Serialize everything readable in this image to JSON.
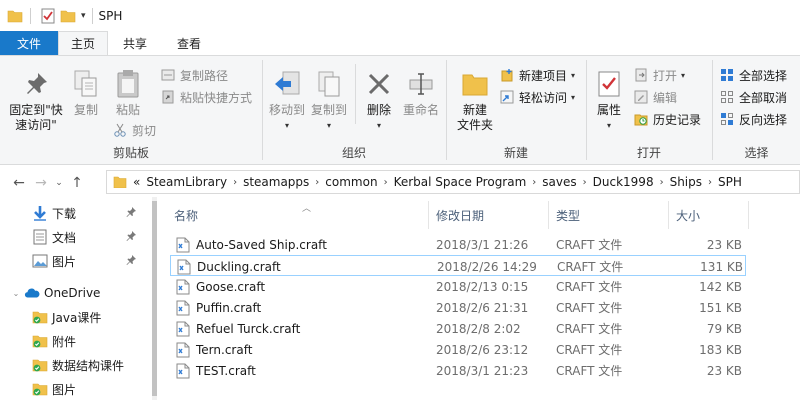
{
  "window": {
    "title": "SPH"
  },
  "ribbon_tabs": {
    "file": "文件",
    "home": "主页",
    "share": "共享",
    "view": "查看"
  },
  "clipboard": {
    "pin_label_1": "固定到\"快",
    "pin_label_2": "速访问\"",
    "copy": "复制",
    "paste": "粘贴",
    "copy_path": "复制路径",
    "paste_shortcut": "粘贴快捷方式",
    "cut": "剪切",
    "group": "剪贴板"
  },
  "organize": {
    "move_to": "移动到",
    "copy_to": "复制到",
    "delete": "删除",
    "rename": "重命名",
    "group": "组织"
  },
  "new": {
    "new_folder_1": "新建",
    "new_folder_2": "文件夹",
    "new_item": "新建项目",
    "easy_access": "轻松访问",
    "group": "新建"
  },
  "open": {
    "properties": "属性",
    "open": "打开",
    "edit": "编辑",
    "history": "历史记录",
    "group": "打开"
  },
  "select": {
    "select_all": "全部选择",
    "select_none": "全部取消",
    "invert": "反向选择",
    "group": "选择"
  },
  "address": {
    "overflow": "«",
    "crumbs": [
      "SteamLibrary",
      "steamapps",
      "common",
      "Kerbal Space Program",
      "saves",
      "Duck1998",
      "Ships",
      "SPH"
    ]
  },
  "nav_pane": {
    "items": [
      {
        "label": "下载",
        "icon": "download-arrow-icon",
        "pinned": true
      },
      {
        "label": "文档",
        "icon": "document-icon",
        "pinned": true
      },
      {
        "label": "图片",
        "icon": "picture-icon",
        "pinned": true
      },
      {
        "label": "OneDrive",
        "icon": "onedrive-cloud-icon"
      },
      {
        "label": "Java课件",
        "icon": "synced-folder-icon"
      },
      {
        "label": "附件",
        "icon": "synced-folder-icon"
      },
      {
        "label": "数据结构课件",
        "icon": "synced-folder-icon"
      },
      {
        "label": "图片",
        "icon": "synced-folder-icon"
      }
    ]
  },
  "columns": {
    "name": "名称",
    "date": "修改日期",
    "type": "类型",
    "size": "大小"
  },
  "files": [
    {
      "name": "Auto-Saved Ship.craft",
      "date": "2018/3/1 21:26",
      "type": "CRAFT 文件",
      "size": "23 KB"
    },
    {
      "name": "Duckling.craft",
      "date": "2018/2/26 14:29",
      "type": "CRAFT 文件",
      "size": "131 KB",
      "selected": true
    },
    {
      "name": "Goose.craft",
      "date": "2018/2/13 0:15",
      "type": "CRAFT 文件",
      "size": "142 KB"
    },
    {
      "name": "Puffin.craft",
      "date": "2018/2/6 21:31",
      "type": "CRAFT 文件",
      "size": "151 KB"
    },
    {
      "name": "Refuel Turck.craft",
      "date": "2018/2/8 2:02",
      "type": "CRAFT 文件",
      "size": "79 KB"
    },
    {
      "name": "Tern.craft",
      "date": "2018/2/6 23:12",
      "type": "CRAFT 文件",
      "size": "183 KB"
    },
    {
      "name": "TEST.craft",
      "date": "2018/3/1 21:23",
      "type": "CRAFT 文件",
      "size": "23 KB"
    }
  ],
  "colors": {
    "accent": "#1979ca",
    "folder": "#f0c14b",
    "selection_border": "#99d1ff",
    "header_text": "#4c607a"
  }
}
